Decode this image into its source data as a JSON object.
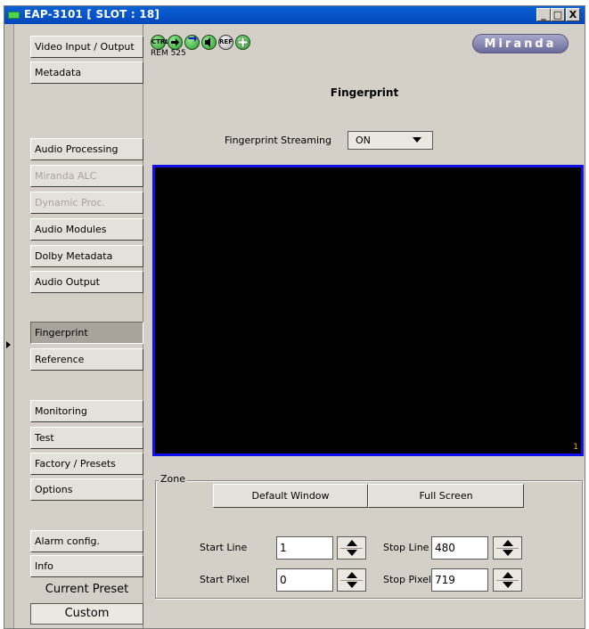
{
  "window": {
    "title": "EAP-3101 [ SLOT : 18]",
    "controls": [
      "_",
      "□",
      "X"
    ]
  },
  "nav": {
    "items": [
      {
        "label": "Video Input / Output",
        "state": "normal"
      },
      {
        "label": "Metadata",
        "state": "normal"
      },
      {
        "label": "Audio Processing",
        "state": "normal"
      },
      {
        "label": "Miranda ALC",
        "state": "disabled"
      },
      {
        "label": "Dynamic Proc.",
        "state": "disabled"
      },
      {
        "label": "Audio Modules",
        "state": "normal"
      },
      {
        "label": "Dolby Metadata",
        "state": "normal"
      },
      {
        "label": "Audio Output",
        "state": "normal"
      },
      {
        "label": "Fingerprint",
        "state": "active"
      },
      {
        "label": "Reference",
        "state": "normal"
      },
      {
        "label": "Monitoring",
        "state": "normal"
      },
      {
        "label": "Test",
        "state": "normal"
      },
      {
        "label": "Factory / Presets",
        "state": "normal"
      },
      {
        "label": "Options",
        "state": "normal"
      },
      {
        "label": "Alarm config.",
        "state": "normal"
      },
      {
        "label": "Info",
        "state": "normal"
      }
    ],
    "current_preset_label": "Current Preset",
    "current_preset_value": "Custom"
  },
  "toolbar": {
    "icons": [
      {
        "name": "ctrl-status-icon",
        "text": "CTRL",
        "color": "#3cb83c"
      },
      {
        "name": "input-arrow-icon",
        "text": "",
        "color": "#3cb83c"
      },
      {
        "name": "loop-icon",
        "text": "",
        "color": "#3cb83c"
      },
      {
        "name": "audio-status-icon",
        "text": "",
        "color": "#3cb83c"
      },
      {
        "name": "ref-status-icon",
        "text": "REF",
        "color": "#c0c0c0"
      },
      {
        "name": "add-icon",
        "text": "",
        "color": "#3cb83c"
      }
    ],
    "rem_text": "REM 525",
    "logo_text": "Miranda"
  },
  "page": {
    "title": "Fingerprint",
    "streaming_label": "Fingerprint Streaming",
    "streaming_value": "ON",
    "video_overlay": "1"
  },
  "zone": {
    "label": "Zone",
    "default_window_label": "Default Window",
    "full_screen_label": "Full Screen",
    "start_line_label": "Start Line",
    "start_line_value": "1",
    "stop_line_label": "Stop Line",
    "stop_line_value": "480",
    "start_pixel_label": "Start Pixel",
    "start_pixel_value": "0",
    "stop_pixel_label": "Stop Pixel",
    "stop_pixel_value": "719"
  },
  "colors": {
    "title_bar": "#0247bb",
    "panel": "#d4d0c8",
    "video_border": "#1010ee",
    "status_green": "#3cb83c"
  }
}
